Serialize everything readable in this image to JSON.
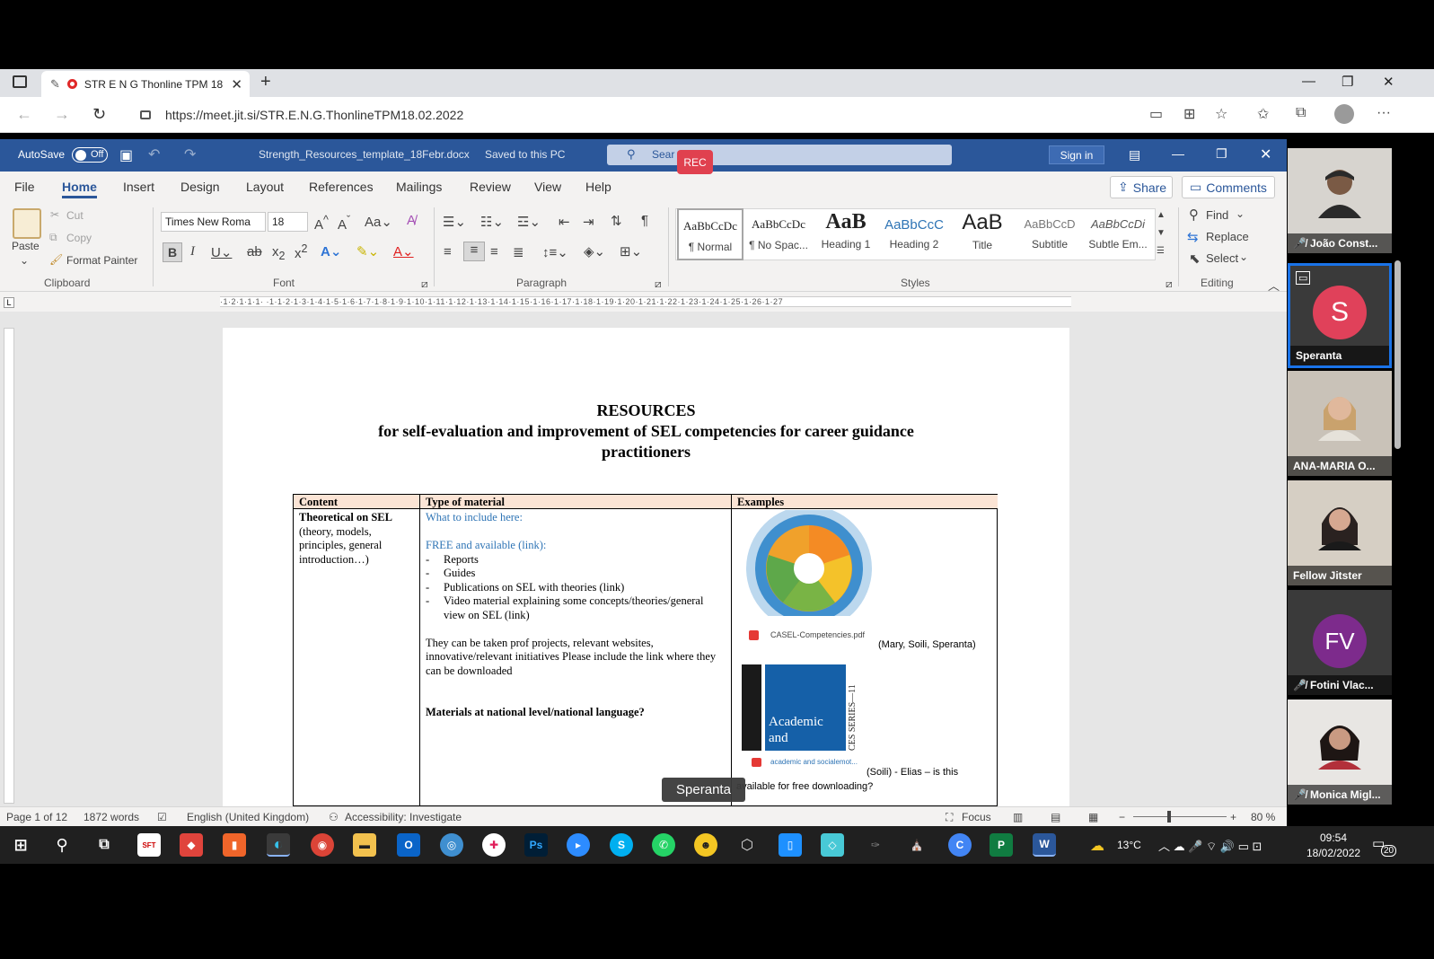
{
  "browser": {
    "tab_title": "STR E N G Thonline TPM 18",
    "url": "https://meet.jit.si/STR.E.N.G.ThonlineTPM18.02.2022"
  },
  "word": {
    "autosave": "AutoSave",
    "autosave_state": "Off",
    "doc_name": "Strength_Resources_template_18Febr.docx",
    "saved": "Saved to this PC",
    "search": "Sear",
    "rec": "REC",
    "signin": "Sign in",
    "menu": [
      "File",
      "Home",
      "Insert",
      "Design",
      "Layout",
      "References",
      "Mailings",
      "Review",
      "View",
      "Help"
    ],
    "share": "Share",
    "comments": "Comments",
    "clipboard": {
      "paste": "Paste",
      "cut": "Cut",
      "copy": "Copy",
      "format_painter": "Format Painter",
      "label": "Clipboard"
    },
    "font": {
      "name": "Times New Roma",
      "size": "18",
      "label": "Font"
    },
    "paragraph_label": "Paragraph",
    "styles_label": "Styles",
    "styles": [
      {
        "sample": "AaBbCcDc",
        "name": "¶ Normal"
      },
      {
        "sample": "AaBbCcDc",
        "name": "¶ No Spac..."
      },
      {
        "sample": "AaB",
        "name": "Heading 1"
      },
      {
        "sample": "AaBbCcC",
        "name": "Heading 2"
      },
      {
        "sample": "AaB",
        "name": "Title"
      },
      {
        "sample": "AaBbCcD",
        "name": "Subtitle"
      },
      {
        "sample": "AaBbCcDi",
        "name": "Subtle Em..."
      }
    ],
    "editing": {
      "find": "Find",
      "replace": "Replace",
      "select": "Select",
      "label": "Editing"
    },
    "ruler_text": "·1·2·1·1·1·  ·1·1·2·1·3·1·4·1·5·1·6·1·7·1·8·1·9·1·10·1·11·1·12·1·13·1·14·1·15·1·16·1·17·1·18·1·19·1·20·1·21·1·22·1·23·1·24·1·25·1·26·1·27",
    "status": {
      "page": "Page 1 of 12",
      "words": "1872 words",
      "language": "English (United Kingdom)",
      "accessibility": "Accessibility: Investigate",
      "focus": "Focus",
      "zoom": "80 %"
    }
  },
  "document": {
    "title": "RESOURCES",
    "subtitle_1": "for self-evaluation and improvement of SEL competencies for career guidance",
    "subtitle_2": "practitioners",
    "headers": [
      "Content",
      "Type of material",
      "Examples"
    ],
    "content_cell_bold": "Theoretical on SEL",
    "content_cell_rest": "(theory, models, principles, general introduction…)",
    "what_to_include": "What to include here:",
    "free_available": "FREE and available (link):",
    "bullets": [
      "Reports",
      "Guides",
      "Publications on SEL with theories (link)",
      "Video material explaining some concepts/theories/general view on SEL (link)"
    ],
    "taken_from": "They can be taken prof projects, relevant websites, innovative/relevant initiatives Please include the link where they can be downloaded",
    "national": "Materials at national level/national language?",
    "casel_file": "CASEL-Competencies.pdf",
    "mary_note": "(Mary, Soili, Speranta)",
    "book_file": "academic and socialemot...",
    "book_title_1": "Academic",
    "book_title_2": "and",
    "book_series": "CES SERIES—11",
    "soili_note": "(Soili) - Elias – is this",
    "soili_note_2": "available for free downloading?"
  },
  "speaker_tag": "Speranta",
  "participants": [
    {
      "name": "João Const...",
      "muted": true,
      "kind": "video"
    },
    {
      "name": "Speranta",
      "initial": "S",
      "color": "#e0415a",
      "kind": "avatar",
      "active": true
    },
    {
      "name": "ANA-MARIA O...",
      "kind": "video"
    },
    {
      "name": "Fellow Jitster",
      "kind": "video"
    },
    {
      "name": "Fotini Vlac...",
      "initial": "FV",
      "color": "#7d2b8c",
      "muted": true,
      "kind": "avatar"
    },
    {
      "name": "Monica Migl...",
      "muted": true,
      "kind": "video"
    }
  ],
  "taskbar": {
    "temp": "13°C",
    "time": "09:54",
    "date": "18/02/2022",
    "notif": "20"
  }
}
